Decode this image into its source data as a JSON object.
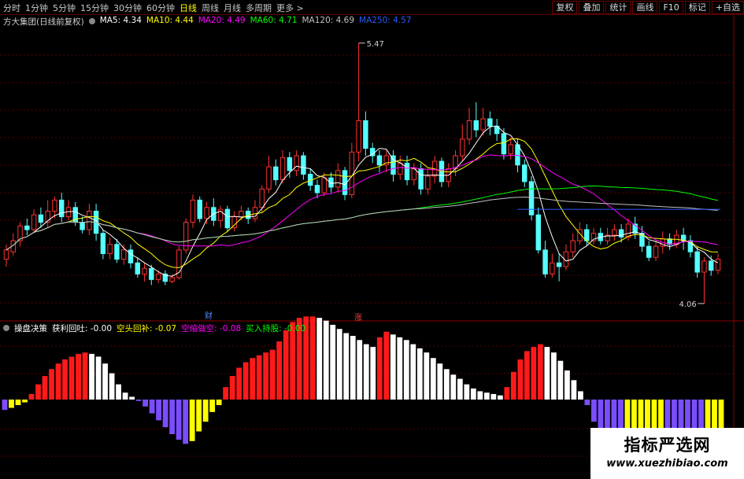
{
  "toolbar": {
    "periods": [
      "分时",
      "1分钟",
      "5分钟",
      "15分钟",
      "30分钟",
      "60分钟",
      "日线",
      "周线",
      "月线",
      "多周期",
      "更多 >"
    ],
    "active_period": "日线",
    "right_buttons": [
      "复权",
      "叠加",
      "统计",
      "画线",
      "F10",
      "标记",
      "+自选"
    ]
  },
  "main_info": {
    "title": "方大集团(日线前复权)",
    "ma_items": [
      {
        "label": "MA5: 4.34",
        "color": "#ffffff"
      },
      {
        "label": "MA10: 4.44",
        "color": "#ffff00"
      },
      {
        "label": "MA20: 4.49",
        "color": "#ff00ff"
      },
      {
        "label": "MA60: 4.71",
        "color": "#00ff00"
      },
      {
        "label": "MA120: 4.69",
        "color": "#c0c0c0"
      },
      {
        "label": "MA250: 4.57",
        "color": "#2a5cff"
      }
    ]
  },
  "indicator_info": {
    "title": "操盘决策",
    "items": [
      {
        "label": "获利回吐: -0.00",
        "color": "#ffffff"
      },
      {
        "label": "空头回补: -0.07",
        "color": "#ffff00"
      },
      {
        "label": "空缩做空: -0.08",
        "color": "#ff00ff"
      },
      {
        "label": "买入持股: -0.00",
        "color": "#00ff00"
      }
    ]
  },
  "annotations": {
    "high_label": "5.47",
    "low_label": "4.06",
    "event_cai": "财",
    "event_zhang": "涨"
  },
  "watermark": {
    "title": "指标严选网",
    "url": "www.xuezhibiao.com"
  },
  "chart_data": {
    "type": "candlestick",
    "price_range": [
      4.0,
      5.55
    ],
    "candles": [
      [
        4.3,
        4.35,
        4.26,
        4.38
      ],
      [
        4.34,
        4.4,
        4.32,
        4.44
      ],
      [
        4.4,
        4.48,
        4.37,
        4.5
      ],
      [
        4.48,
        4.46,
        4.43,
        4.52
      ],
      [
        4.46,
        4.54,
        4.44,
        4.57
      ],
      [
        4.54,
        4.5,
        4.47,
        4.58
      ],
      [
        4.5,
        4.56,
        4.47,
        4.62
      ],
      [
        4.56,
        4.62,
        4.52,
        4.64
      ],
      [
        4.62,
        4.53,
        4.5,
        4.66
      ],
      [
        4.53,
        4.58,
        4.51,
        4.62
      ],
      [
        4.58,
        4.5,
        4.48,
        4.61
      ],
      [
        4.5,
        4.46,
        4.44,
        4.53
      ],
      [
        4.46,
        4.56,
        4.43,
        4.6
      ],
      [
        4.56,
        4.44,
        4.4,
        4.6
      ],
      [
        4.44,
        4.33,
        4.3,
        4.46
      ],
      [
        4.33,
        4.38,
        4.3,
        4.42
      ],
      [
        4.38,
        4.3,
        4.28,
        4.41
      ],
      [
        4.3,
        4.35,
        4.27,
        4.38
      ],
      [
        4.35,
        4.28,
        4.25,
        4.38
      ],
      [
        4.28,
        4.22,
        4.2,
        4.31
      ],
      [
        4.22,
        4.25,
        4.18,
        4.28
      ],
      [
        4.25,
        4.19,
        4.16,
        4.27
      ],
      [
        4.19,
        4.22,
        4.17,
        4.24
      ],
      [
        4.22,
        4.18,
        4.16,
        4.24
      ],
      [
        4.18,
        4.2,
        4.17,
        4.22
      ],
      [
        4.2,
        4.35,
        4.19,
        4.37
      ],
      [
        4.35,
        4.5,
        4.33,
        4.52
      ],
      [
        4.5,
        4.62,
        4.47,
        4.65
      ],
      [
        4.62,
        4.52,
        4.5,
        4.64
      ],
      [
        4.52,
        4.58,
        4.49,
        4.61
      ],
      [
        4.58,
        4.51,
        4.48,
        4.63
      ],
      [
        4.51,
        4.57,
        4.47,
        4.59
      ],
      [
        4.57,
        4.47,
        4.45,
        4.59
      ],
      [
        4.47,
        4.53,
        4.45,
        4.56
      ],
      [
        4.53,
        4.56,
        4.51,
        4.59
      ],
      [
        4.56,
        4.52,
        4.49,
        4.58
      ],
      [
        4.52,
        4.58,
        4.5,
        4.62
      ],
      [
        4.58,
        4.68,
        4.55,
        4.7
      ],
      [
        4.68,
        4.8,
        4.66,
        4.86
      ],
      [
        4.8,
        4.73,
        4.7,
        4.84
      ],
      [
        4.73,
        4.85,
        4.71,
        4.89
      ],
      [
        4.85,
        4.78,
        4.74,
        4.88
      ],
      [
        4.78,
        4.86,
        4.75,
        4.89
      ],
      [
        4.86,
        4.76,
        4.73,
        4.88
      ],
      [
        4.76,
        4.7,
        4.67,
        4.79
      ],
      [
        4.7,
        4.66,
        4.63,
        4.73
      ],
      [
        4.66,
        4.74,
        4.64,
        4.77
      ],
      [
        4.74,
        4.69,
        4.66,
        4.77
      ],
      [
        4.69,
        4.78,
        4.66,
        4.82
      ],
      [
        4.78,
        4.65,
        4.62,
        4.8
      ],
      [
        4.65,
        4.88,
        4.63,
        4.93
      ],
      [
        4.88,
        5.05,
        4.83,
        5.47
      ],
      [
        5.05,
        4.9,
        4.86,
        5.1
      ],
      [
        4.9,
        4.86,
        4.82,
        4.93
      ],
      [
        4.86,
        4.81,
        4.77,
        4.89
      ],
      [
        4.81,
        4.86,
        4.77,
        4.89
      ],
      [
        4.86,
        4.76,
        4.72,
        4.89
      ],
      [
        4.76,
        4.82,
        4.73,
        4.86
      ],
      [
        4.82,
        4.73,
        4.7,
        4.86
      ],
      [
        4.73,
        4.79,
        4.7,
        4.82
      ],
      [
        4.79,
        4.68,
        4.65,
        4.82
      ],
      [
        4.68,
        4.75,
        4.65,
        4.79
      ],
      [
        4.75,
        4.83,
        4.71,
        4.86
      ],
      [
        4.83,
        4.72,
        4.69,
        4.85
      ],
      [
        4.72,
        4.79,
        4.69,
        4.82
      ],
      [
        4.79,
        4.86,
        4.75,
        4.89
      ],
      [
        4.86,
        4.95,
        4.83,
        5.03
      ],
      [
        4.95,
        5.05,
        4.92,
        5.12
      ],
      [
        5.05,
        5.0,
        4.96,
        5.15
      ],
      [
        5.0,
        5.06,
        4.97,
        5.12
      ],
      [
        5.06,
        5.02,
        4.97,
        5.1
      ],
      [
        5.02,
        4.98,
        4.94,
        5.06
      ],
      [
        4.98,
        4.87,
        4.84,
        5.01
      ],
      [
        4.87,
        4.92,
        4.84,
        4.96
      ],
      [
        4.92,
        4.81,
        4.77,
        4.95
      ],
      [
        4.81,
        4.72,
        4.69,
        4.84
      ],
      [
        4.72,
        4.54,
        4.51,
        4.75
      ],
      [
        4.54,
        4.35,
        4.33,
        4.58
      ],
      [
        4.35,
        4.22,
        4.2,
        4.4
      ],
      [
        4.22,
        4.28,
        4.2,
        4.33
      ],
      [
        4.28,
        4.26,
        4.18,
        4.33
      ],
      [
        4.26,
        4.34,
        4.24,
        4.38
      ],
      [
        4.34,
        4.4,
        4.31,
        4.44
      ],
      [
        4.4,
        4.46,
        4.38,
        4.5
      ],
      [
        4.46,
        4.4,
        4.37,
        4.49
      ],
      [
        4.4,
        4.44,
        4.38,
        4.47
      ],
      [
        4.44,
        4.4,
        4.38,
        4.47
      ],
      [
        4.4,
        4.43,
        4.38,
        4.47
      ],
      [
        4.43,
        4.46,
        4.4,
        4.49
      ],
      [
        4.46,
        4.42,
        4.39,
        4.49
      ],
      [
        4.42,
        4.49,
        4.4,
        4.52
      ],
      [
        4.49,
        4.44,
        4.41,
        4.53
      ],
      [
        4.44,
        4.37,
        4.34,
        4.48
      ],
      [
        4.37,
        4.31,
        4.29,
        4.4
      ],
      [
        4.31,
        4.37,
        4.29,
        4.4
      ],
      [
        4.37,
        4.41,
        4.33,
        4.45
      ],
      [
        4.41,
        4.38,
        4.35,
        4.44
      ],
      [
        4.38,
        4.43,
        4.36,
        4.46
      ],
      [
        4.43,
        4.4,
        4.35,
        4.47
      ],
      [
        4.4,
        4.34,
        4.31,
        4.43
      ],
      [
        4.34,
        4.23,
        4.2,
        4.37
      ],
      [
        4.23,
        4.29,
        4.06,
        4.31
      ],
      [
        4.29,
        4.24,
        4.21,
        4.32
      ],
      [
        4.24,
        4.3,
        4.22,
        4.33
      ]
    ],
    "ma_series": [
      {
        "name": "MA5",
        "color": "#ffffff"
      },
      {
        "name": "MA10",
        "color": "#ffff00"
      },
      {
        "name": "MA20",
        "color": "#ff00ff"
      },
      {
        "name": "MA60",
        "color": "#00ff00"
      },
      {
        "name": "MA120",
        "color": "#c0c0c0"
      },
      {
        "name": "MA250",
        "color": "#2a5cff"
      }
    ],
    "ma250_level": 4.57,
    "indicator": {
      "range": [
        -1.0,
        1.0
      ],
      "values": [
        -0.15,
        -0.12,
        -0.08,
        -0.04,
        0.08,
        0.22,
        0.34,
        0.44,
        0.52,
        0.58,
        0.62,
        0.66,
        0.68,
        0.66,
        0.62,
        0.52,
        0.38,
        0.22,
        0.1,
        0.04,
        -0.02,
        -0.1,
        -0.2,
        -0.3,
        -0.4,
        -0.5,
        -0.58,
        -0.64,
        -0.6,
        -0.46,
        -0.32,
        -0.18,
        -0.08,
        0.18,
        0.34,
        0.46,
        0.54,
        0.6,
        0.64,
        0.68,
        0.72,
        0.84,
        1.0,
        1.12,
        1.18,
        1.2,
        1.2,
        1.18,
        1.14,
        1.08,
        1.02,
        0.96,
        0.92,
        0.86,
        0.8,
        0.76,
        0.9,
        0.98,
        0.94,
        0.9,
        0.86,
        0.8,
        0.74,
        0.68,
        0.6,
        0.52,
        0.44,
        0.36,
        0.3,
        0.22,
        0.16,
        0.12,
        0.1,
        0.08,
        0.06,
        0.18,
        0.4,
        0.58,
        0.7,
        0.76,
        0.8,
        0.76,
        0.68,
        0.56,
        0.42,
        0.28,
        0.12,
        -0.08,
        -0.32,
        -0.6,
        -0.86,
        -1.08,
        -1.22,
        -1.2,
        -1.06,
        -0.9,
        -0.76,
        -0.66,
        -0.6,
        -0.62,
        -0.66,
        -0.7,
        -0.72,
        -0.74,
        -0.74,
        -0.72,
        -0.7,
        -0.68
      ],
      "colors": {
        "up": "#ff1a1a",
        "up_fading": "#ffffff",
        "down": "#7b4dff",
        "down_fading": "#ffff00"
      }
    }
  }
}
